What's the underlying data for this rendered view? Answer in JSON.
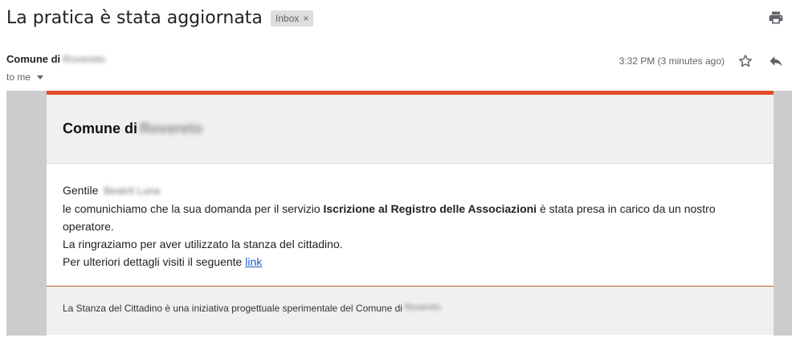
{
  "email": {
    "subject": "La pratica è stata aggiornata",
    "label": "Inbox",
    "label_remove": "×",
    "sender_prefix": "Comune di",
    "sender_redacted": "Rovereto",
    "recipient": "to me",
    "timestamp": "3:32 PM (3 minutes ago)",
    "icons": {
      "print": "print-icon",
      "star": "star-icon",
      "reply": "reply-icon",
      "dropdown": "caret-down-icon"
    }
  },
  "message": {
    "accent_color": "#e24e29",
    "header_prefix": "Comune di",
    "header_redacted": "Rovereto",
    "greeting": "Gentile",
    "greeting_name_redacted": "Beatrit Luna",
    "line1_before": "le comunichiamo che la sua domanda per il servizio ",
    "line1_bold": "Iscrizione al Registro delle Associazioni",
    "line1_after": " è stata presa in carico da un nostro operatore.",
    "line2": "La ringraziamo per aver utilizzato la stanza del cittadino.",
    "line3_before": "Per ulteriori dettagli visiti il seguente ",
    "link_label": "link",
    "footer_prefix": "La Stanza del Cittadino è una iniziativa progettuale sperimentale del Comune di",
    "footer_redacted": "Rovereto"
  }
}
